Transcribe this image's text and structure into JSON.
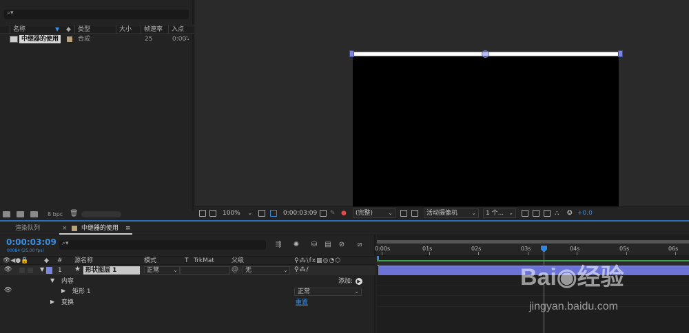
{
  "project_panel": {
    "search_icon": "⌕▾",
    "columns": [
      "名称",
      "类型",
      "大小",
      "帧速率",
      "入点"
    ],
    "items": [
      {
        "name": "中继器的使用",
        "type": "合成",
        "fps": "25",
        "in_point": "0:00"
      }
    ],
    "footer": {
      "bpc": "8 bpc"
    }
  },
  "viewer_bar": {
    "zoom": "100%",
    "timecode": "0:00:03:09",
    "resolution": "(完整)",
    "camera": "活动摄像机",
    "views": "1 个...",
    "exposure": "+0.0"
  },
  "timeline": {
    "tabs": {
      "render_queue": "渲染队列",
      "close": "×",
      "comp": "中继器的使用",
      "menu": "≡"
    },
    "timecode": "0:00:03:09",
    "timecode_sub": "00084 (25.00 fps)",
    "columns": {
      "num": "#",
      "source": "源名称",
      "mode": "模式",
      "t": "T",
      "trkmat": "TrkMat",
      "parent": "父级"
    },
    "layer": {
      "num": "1",
      "name": "形状图层 1",
      "mode": "正常",
      "parent": "无"
    },
    "properties": {
      "contents": "内容",
      "add": "添加:",
      "rect": "矩形 1",
      "rect_mode": "正常",
      "transform": "变换",
      "reset": "重置"
    },
    "ruler": [
      "0:00s",
      "01s",
      "02s",
      "03s",
      "04s",
      "05s",
      "06s"
    ]
  },
  "watermark": {
    "logo": "Bai◉经验",
    "url": "jingyan.baidu.com"
  },
  "colors": {
    "accent": "#2f87e0",
    "layer": "#6b74d6",
    "comp_label": "#b8a27a"
  }
}
